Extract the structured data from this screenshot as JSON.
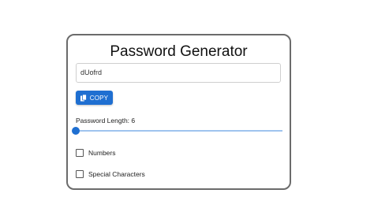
{
  "title": "Password Generator",
  "password": "dUofrd",
  "copy": {
    "label": "COPY",
    "icon": "copy-icon"
  },
  "length": {
    "label": "Password Length: 6",
    "value": 6,
    "min": 6,
    "max": 30
  },
  "options": [
    {
      "label": "Numbers",
      "checked": false
    },
    {
      "label": "Special Characters",
      "checked": false
    }
  ],
  "colors": {
    "accent": "#1f6fd1",
    "track": "#9fc4ee",
    "border": "#6b6b6b"
  }
}
